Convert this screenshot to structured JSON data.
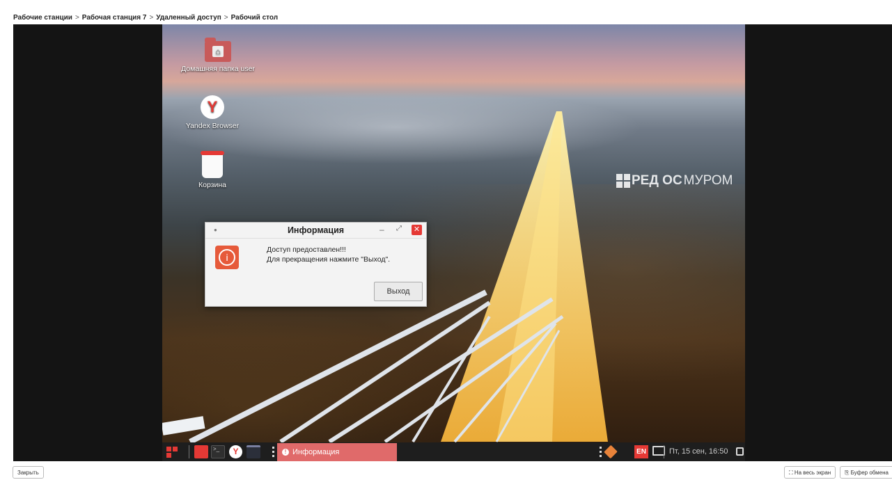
{
  "breadcrumb": {
    "items": [
      "Рабочие станции",
      "Рабочая станция 7",
      "Удаленный доступ",
      "Рабочий стол"
    ],
    "separator": ">"
  },
  "desktop": {
    "icons": [
      {
        "label": "Домашняя папка user",
        "icon": "home-folder-icon"
      },
      {
        "label": "Yandex Browser",
        "icon": "yandex-browser-icon"
      },
      {
        "label": "Корзина",
        "icon": "trash-icon"
      }
    ],
    "watermark": {
      "brand_bold": "РЕД ОС",
      "brand_thin": "МУРОМ"
    }
  },
  "dialog": {
    "title": "Информация",
    "message_line1": "Доступ предоставлен!!!",
    "message_line2": "Для прекращения нажмите \"Выход\".",
    "exit_button": "Выход"
  },
  "taskbar": {
    "active_task": "Информация",
    "keyboard_layout": "EN",
    "clock": "Пт, 15 сен, 16:50"
  },
  "footer": {
    "close_label": "Закрыть",
    "fullscreen_label": "На весь экран",
    "clipboard_label": "Буфер обмена"
  },
  "colors": {
    "accent_red": "#e53935",
    "task_highlight": "#e06a6a"
  }
}
